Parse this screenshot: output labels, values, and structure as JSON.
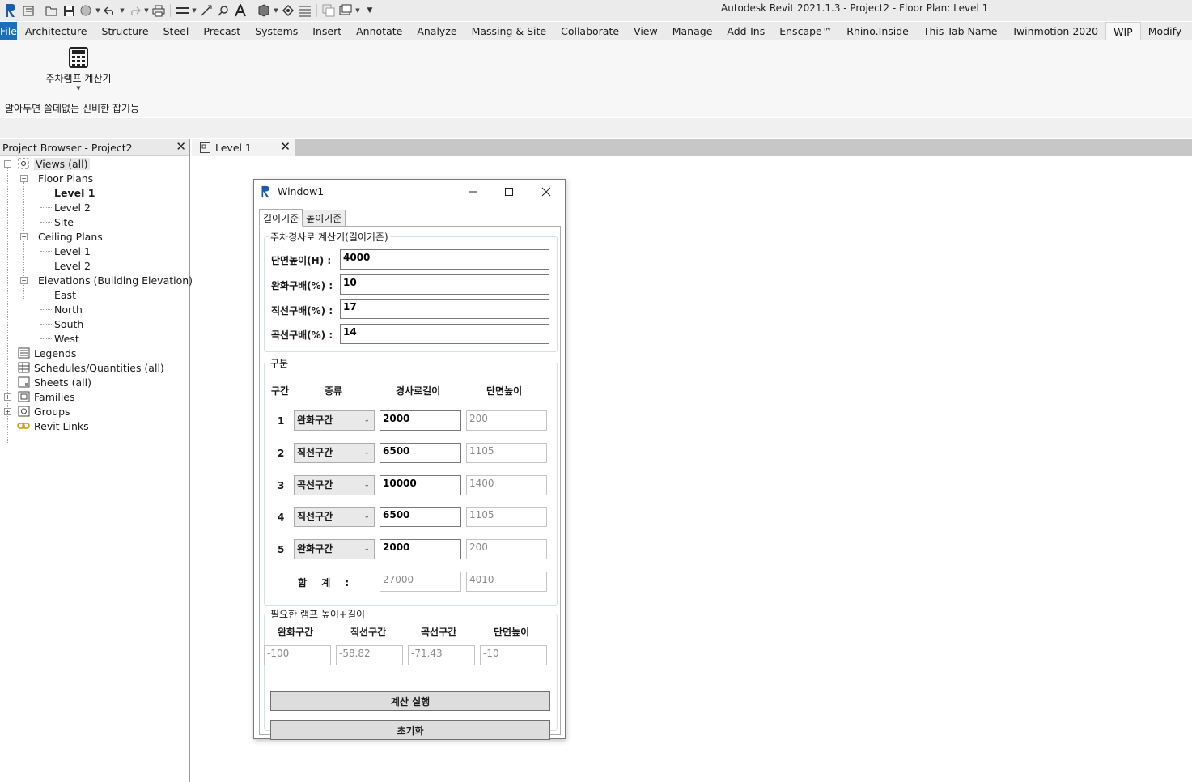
{
  "app": {
    "title": "Autodesk Revit 2021.1.3 - Project2 - Floor Plan: Level 1"
  },
  "qat_icons": [
    "revit-logo-icon",
    "recent-icon",
    "open-icon",
    "save-icon",
    "sync-icon",
    "undo-icon",
    "redo-icon",
    "print-icon",
    "measure-icon",
    "dimension-icon",
    "tag-icon",
    "text-icon",
    "3d-view-icon",
    "section-icon",
    "thin-lines-icon",
    "close-hidden-icon",
    "switch-windows-icon",
    "customize-icon"
  ],
  "ribbon": {
    "tabs": [
      "File",
      "Architecture",
      "Structure",
      "Steel",
      "Precast",
      "Systems",
      "Insert",
      "Annotate",
      "Analyze",
      "Massing & Site",
      "Collaborate",
      "View",
      "Manage",
      "Add-Ins",
      "Enscape™",
      "Rhino.Inside",
      "This Tab Name",
      "Twinmotion 2020",
      "WIP",
      "Modify"
    ],
    "active_tab": "WIP",
    "tool_label": "주차램프 계산기",
    "panel_title": "알아두면 쓸데없는 신비한 잡기능"
  },
  "browser": {
    "title": "Project Browser - Project2",
    "items": [
      {
        "label": "Views (all)"
      },
      {
        "label": "Floor Plans"
      },
      {
        "label": "Level 1"
      },
      {
        "label": "Level 2"
      },
      {
        "label": "Site"
      },
      {
        "label": "Ceiling Plans"
      },
      {
        "label": "Level 1"
      },
      {
        "label": "Level 2"
      },
      {
        "label": "Elevations (Building Elevation)"
      },
      {
        "label": "East"
      },
      {
        "label": "North"
      },
      {
        "label": "South"
      },
      {
        "label": "West"
      },
      {
        "label": "Legends"
      },
      {
        "label": "Schedules/Quantities (all)"
      },
      {
        "label": "Sheets (all)"
      },
      {
        "label": "Families"
      },
      {
        "label": "Groups"
      },
      {
        "label": "Revit Links"
      }
    ]
  },
  "view_tab": {
    "label": "Level 1"
  },
  "dialog": {
    "title": "Window1",
    "tabs": [
      "길이기준",
      "높이기준"
    ],
    "input_group": {
      "title": "주차경사로 계산기(길이기준)",
      "fields": [
        {
          "label": "단면높이(H) :",
          "value": "4000"
        },
        {
          "label": "완화구배(%) :",
          "value": "10"
        },
        {
          "label": "직선구배(%) :",
          "value": "17"
        },
        {
          "label": "곡선구배(%) :",
          "value": "14"
        }
      ]
    },
    "section_group": {
      "title": "구분",
      "headers": [
        "구간",
        "종류",
        "경사로길이",
        "단면높이"
      ],
      "rows": [
        {
          "num": "1",
          "type": "완화구간",
          "length": "2000",
          "height": "200"
        },
        {
          "num": "2",
          "type": "직선구간",
          "length": "6500",
          "height": "1105"
        },
        {
          "num": "3",
          "type": "곡선구간",
          "length": "10000",
          "height": "1400"
        },
        {
          "num": "4",
          "type": "직선구간",
          "length": "6500",
          "height": "1105"
        },
        {
          "num": "5",
          "type": "완화구간",
          "length": "2000",
          "height": "200"
        }
      ],
      "total_label": "합 계 :",
      "total_length": "27000",
      "total_height": "4010"
    },
    "required_group": {
      "title": "필요한 램프 높이+길이",
      "headers": [
        "완화구간",
        "직선구간",
        "곡선구간",
        "단면높이"
      ],
      "values": [
        "-100",
        "-58.82",
        "-71.43",
        "-10"
      ]
    },
    "run_button": "계산 실행",
    "reset_button": "초기화"
  }
}
